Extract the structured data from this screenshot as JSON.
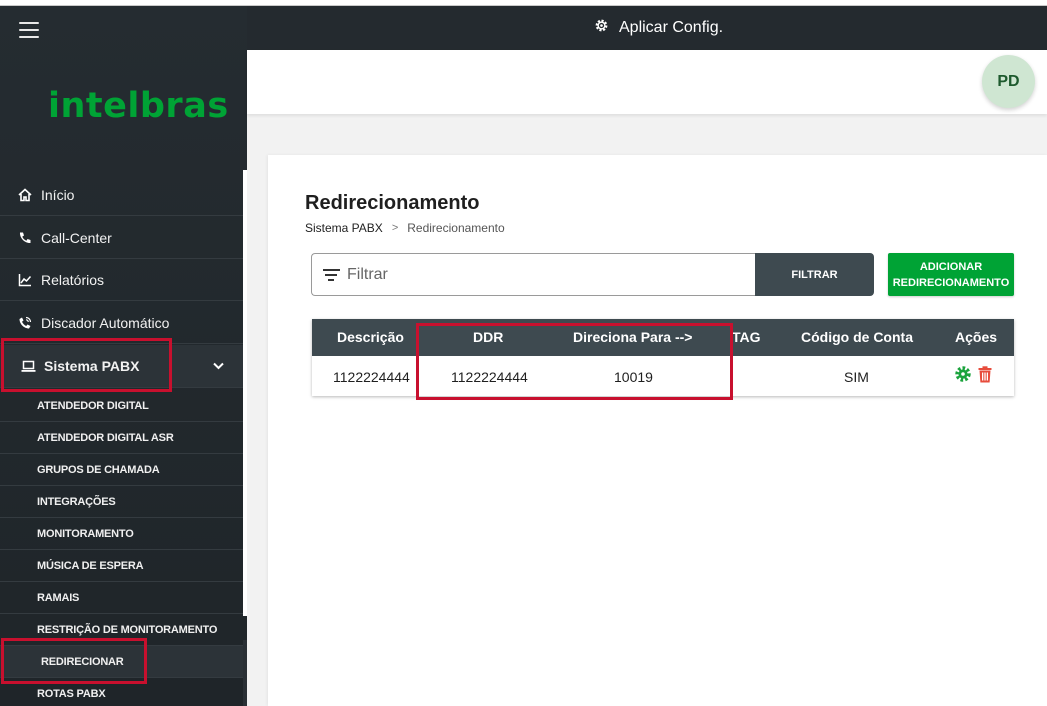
{
  "sidebar": {
    "logo": "intelbras",
    "items": [
      {
        "label": "Início",
        "icon": "home-icon"
      },
      {
        "label": "Call-Center",
        "icon": "phone-icon"
      },
      {
        "label": "Relatórios",
        "icon": "chart-line-icon"
      },
      {
        "label": "Discador Automático",
        "icon": "phone-dial-icon"
      },
      {
        "label": "Sistema PABX",
        "icon": "laptop-icon"
      }
    ],
    "subitems": [
      "ATENDEDOR DIGITAL",
      "ATENDEDOR DIGITAL ASR",
      "GRUPOS DE CHAMADA",
      "INTEGRAÇÕES",
      "MONITORAMENTO",
      "MÚSICA DE ESPERA",
      "RAMAIS",
      "RESTRIÇÃO DE MONITORAMENTO",
      "REDIRECIONAR",
      "ROTAS PABX"
    ]
  },
  "topbar": {
    "apply_label": "Aplicar Config."
  },
  "user": {
    "initials": "PD"
  },
  "page": {
    "title": "Redirecionamento",
    "breadcrumb": {
      "root": "Sistema PABX",
      "separator": ">",
      "current": "Redirecionamento"
    }
  },
  "filter": {
    "placeholder": "Filtrar",
    "button": "FILTRAR"
  },
  "add_button": {
    "line1": "ADICIONAR",
    "line2": "REDIRECIONAMENTO"
  },
  "table": {
    "columns": [
      "Descrição",
      "DDR",
      "Direciona Para -->",
      "TAG",
      "Código de Conta",
      "Ações"
    ],
    "rows": [
      {
        "descricao": "1122224444",
        "ddr": "1122224444",
        "direciona": "10019",
        "tag": "",
        "codigo": "SIM"
      }
    ]
  },
  "colors": {
    "accent": "#00a335",
    "highlight": "#c8102e",
    "header_dark": "#3e4a50",
    "delete": "#e74c3c"
  }
}
